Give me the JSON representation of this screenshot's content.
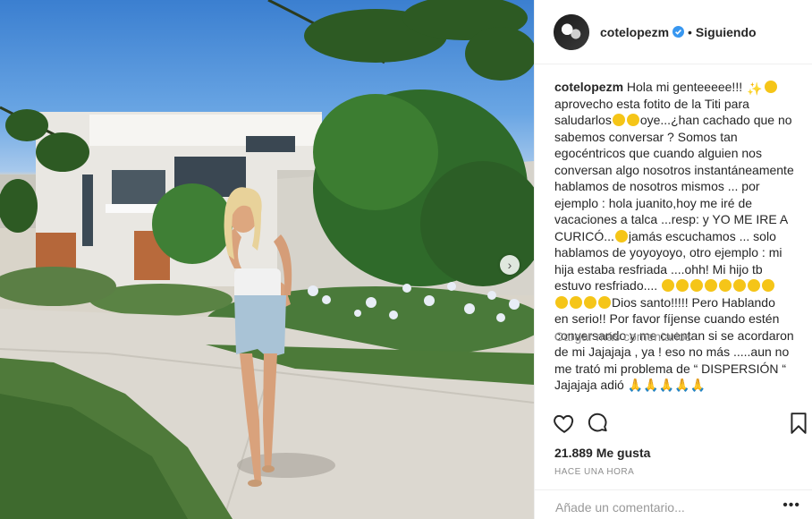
{
  "post": {
    "username": "cotelopezm",
    "follow_status": "Siguiendo",
    "separator": "•",
    "caption_user": "cotelopezm",
    "caption_lines": [
      "Hola mi genteeeee!!!",
      "aprovecho esta fotito de la Titi para",
      "saludarlos",
      "oye...¿han cachado que no",
      "sabemos conversar ? Somos tan",
      "egocéntricos que cuando alguien nos",
      "conversan algo nosotros instantáneamente",
      "hablamos de nosotros mismos ... por",
      "ejemplo : hola juanito,hoy me iré de",
      "vacaciones a talca ...resp: y YO ME IRE A",
      "CURICÓ...",
      "jamás escuchamos ... solo",
      "hablamos de yoyoyoyo, otro ejemplo : mi",
      "hija estaba resfriada ....ohh! Mi hijo tb",
      "estuvo resfriado....",
      "Dios santo!!!!! Pero Hablando",
      "en serio!! Por favor fíjense cuando estén",
      "conversando y me cuentan si se acordaron",
      "de mi Jajajaja , ya ! eso no más .....aun no",
      "me trató mi problema de “ DISPERSIÓN “",
      "Jajajaja adió 🙏🙏🙏🙏🙏"
    ],
    "load_more": "Cargar más comentarios",
    "likes": "21.889 Me gusta",
    "time": "HACE UNA HORA",
    "comment_placeholder": "Añade un comentario...",
    "more_options": "•••"
  },
  "icons": {
    "verified": "verified-badge-icon",
    "like": "heart-icon",
    "comment": "comment-icon",
    "save": "bookmark-icon",
    "next": "chevron-right-icon"
  },
  "colors": {
    "verified": "#3897f0",
    "muted": "#8e8e8e",
    "text": "#262626"
  }
}
